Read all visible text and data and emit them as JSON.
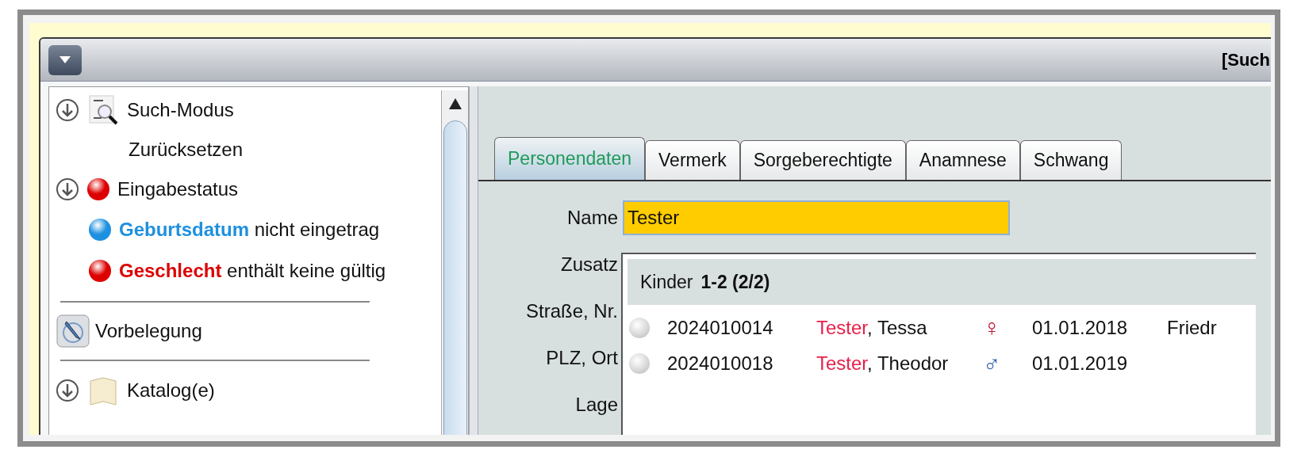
{
  "window": {
    "title": "[Such"
  },
  "sidebar": {
    "items": [
      {
        "kind": "search-group",
        "label": "Such-Modus"
      },
      {
        "kind": "action",
        "label": "Zurücksetzen"
      },
      {
        "kind": "status",
        "color": "#dd0000",
        "label": "Eingabestatus"
      },
      {
        "kind": "message",
        "color": "#1e90e0",
        "field": "Geburtsdatum",
        "message": "nicht eingetrag"
      },
      {
        "kind": "message",
        "color": "#dd0000",
        "field": "Geschlecht",
        "message": "enthält keine gültig"
      },
      {
        "kind": "separator"
      },
      {
        "kind": "preset",
        "label": "Vorbelegung"
      },
      {
        "kind": "separator"
      },
      {
        "kind": "catalog-group",
        "label": "Katalog(e)"
      }
    ]
  },
  "tabs": [
    {
      "label": "Personendaten",
      "selected": true
    },
    {
      "label": "Vermerk",
      "selected": false
    },
    {
      "label": "Sorgeberechtigte",
      "selected": false
    },
    {
      "label": "Anamnese",
      "selected": false
    },
    {
      "label": "Schwang",
      "selected": false
    }
  ],
  "form": {
    "fields": [
      {
        "label": "Name",
        "value": "Tester"
      },
      {
        "label": "Zusatz"
      },
      {
        "label": "Straße, Nr."
      },
      {
        "label": "PLZ, Ort"
      },
      {
        "label": "Lage"
      }
    ]
  },
  "popup": {
    "title": "Kinder",
    "range": "1-2 (2/2)",
    "rows": [
      {
        "id": "2024010014",
        "surname": "Tester",
        "given": ", Tessa",
        "symbol": "♀",
        "color": "#c0102a",
        "birth": "01.01.2018",
        "extra": "Friedr"
      },
      {
        "id": "2024010018",
        "surname": "Tester",
        "given": ", Theodor",
        "symbol": "♂",
        "color": "#3060b0",
        "birth": "01.01.2019"
      }
    ]
  }
}
